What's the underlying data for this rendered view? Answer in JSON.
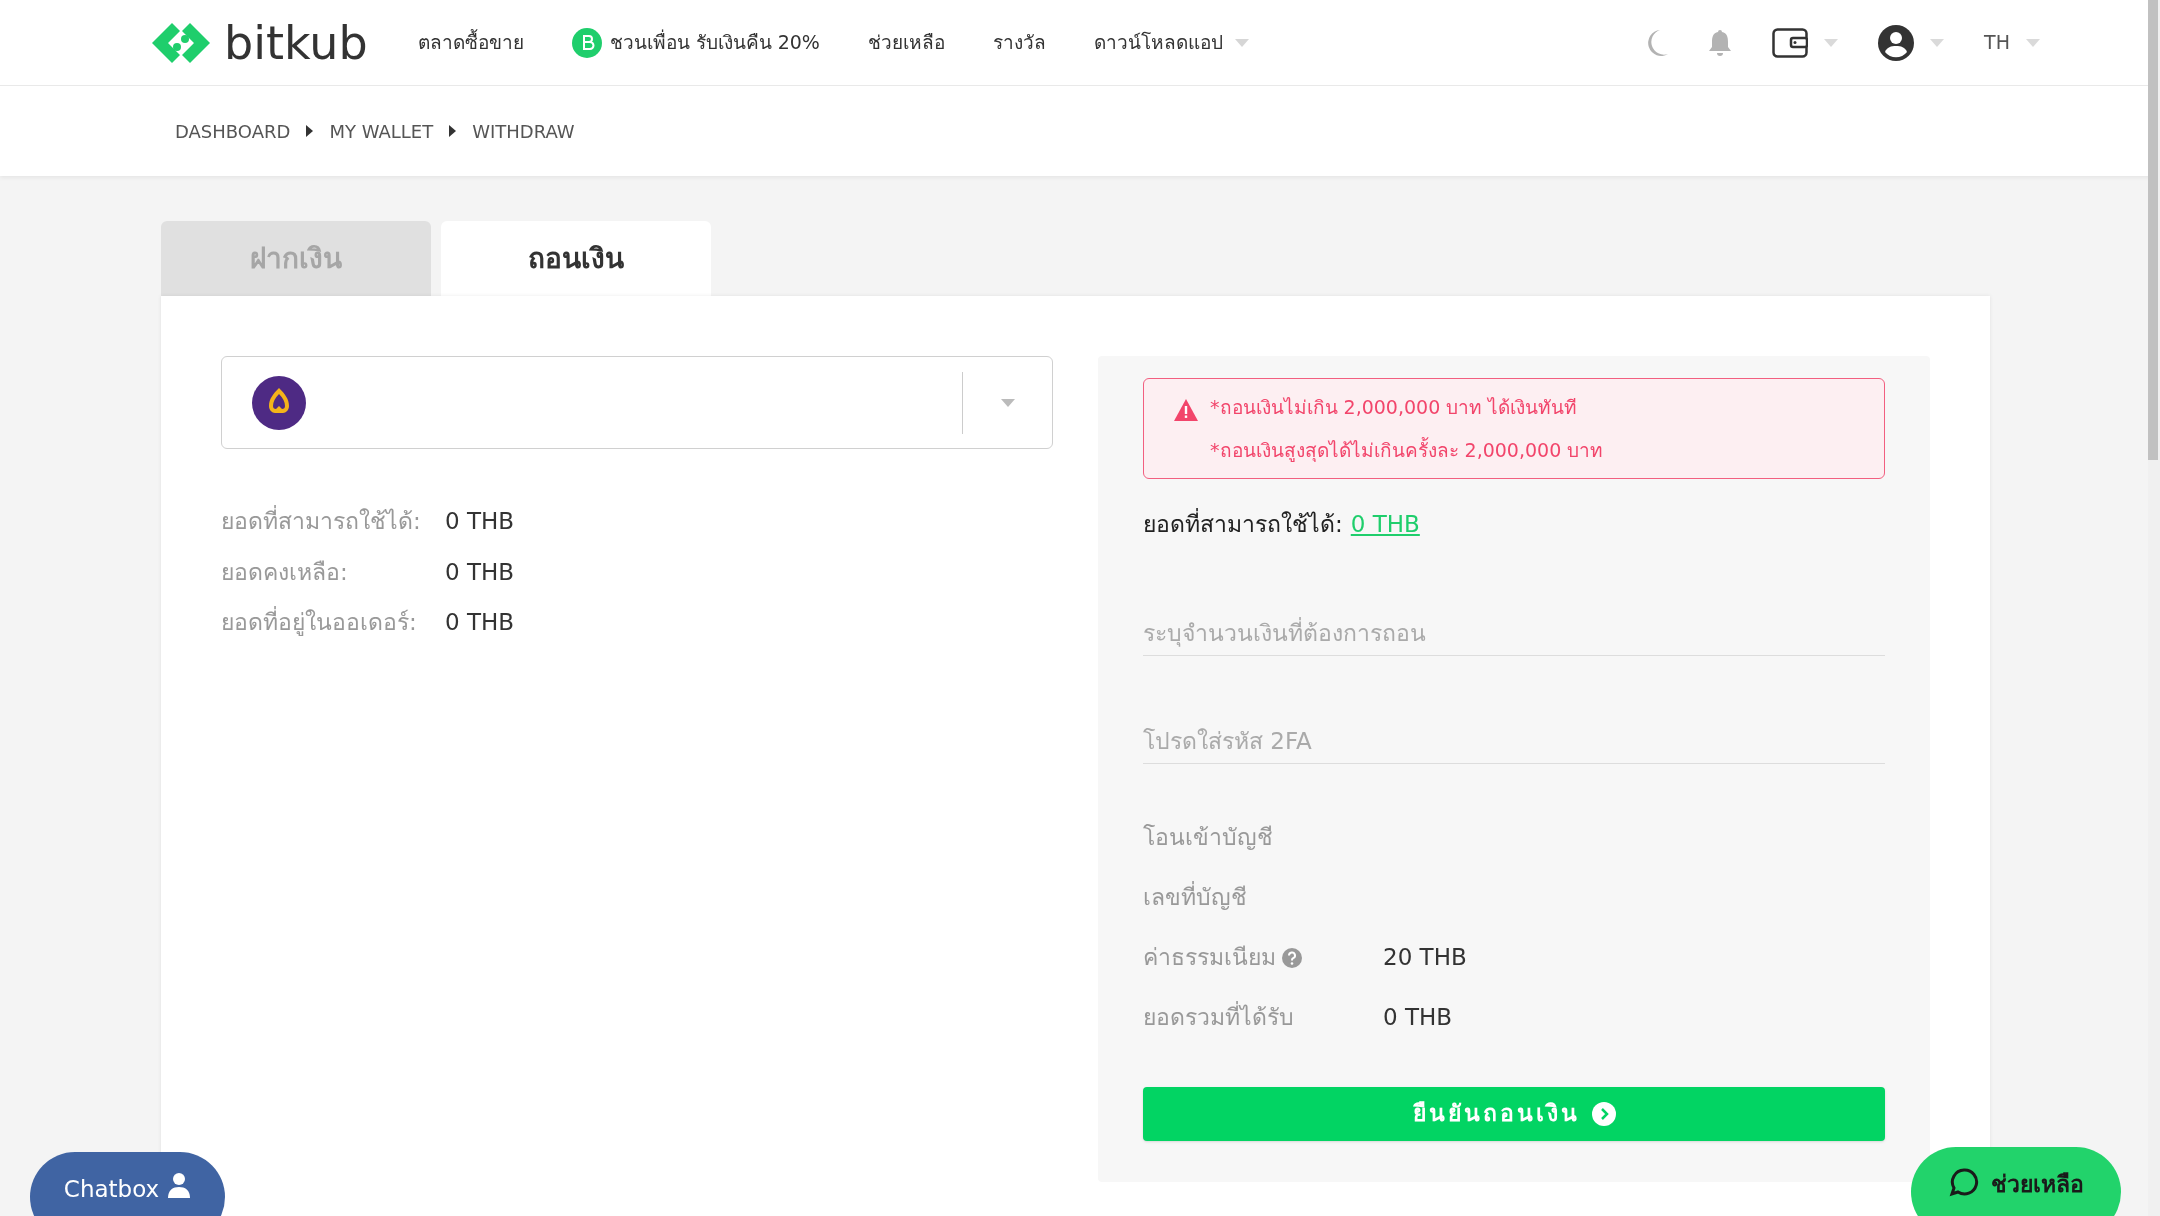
{
  "header": {
    "logo": "bitkub",
    "nav": [
      {
        "label": "ตลาดซื้อขาย",
        "kind": "plain"
      },
      {
        "label": "ชวนเพื่อน รับเงินคืน 20%",
        "kind": "coin"
      },
      {
        "label": "ช่วยเหลือ",
        "kind": "plain"
      },
      {
        "label": "รางวัล",
        "kind": "plain"
      },
      {
        "label": "ดาวน์โหลดแอป",
        "kind": "dropdown"
      }
    ],
    "language": "TH"
  },
  "breadcrumb": [
    "DASHBOARD",
    "MY WALLET",
    "WITHDRAW"
  ],
  "tabs": [
    {
      "label": "ฝากเงิน",
      "selected": false
    },
    {
      "label": "ถอนเงิน",
      "selected": true
    }
  ],
  "balances": [
    {
      "label": "ยอดที่สามารถใช้ได้:",
      "value": "0 THB"
    },
    {
      "label": "ยอดคงเหลือ:",
      "value": "0 THB"
    },
    {
      "label": "ยอดที่อยู่ในออเดอร์:",
      "value": "0 THB"
    }
  ],
  "warning": [
    "*ถอนเงินไม่เกิน 2,000,000 บาท ได้เงินทันที",
    "*ถอนเงินสูงสุดได้ไม่เกินครั้งละ 2,000,000 บาท"
  ],
  "available": {
    "label": "ยอดที่สามารถใช้ได้:",
    "value": "0 THB"
  },
  "fields": [
    {
      "placeholder": "ระบุจำนวนเงินที่ต้องการถอน"
    },
    {
      "placeholder": "โปรดใส่รหัส 2FA"
    }
  ],
  "details": [
    {
      "label": "โอนเข้าบัญชี",
      "kind": "plain"
    },
    {
      "label": "เลขที่บัญชี",
      "kind": "plain"
    },
    {
      "label": "ค่าธรรมเนียม",
      "value": "20 THB",
      "kind": "help"
    },
    {
      "label": "ยอดรวมที่ได้รับ",
      "value": "0 THB",
      "kind": "plain"
    }
  ],
  "confirm_button": "ยืนยันถอนเงิน",
  "chatbox": "Chatbox",
  "help_button": "ช่วยเหลือ"
}
